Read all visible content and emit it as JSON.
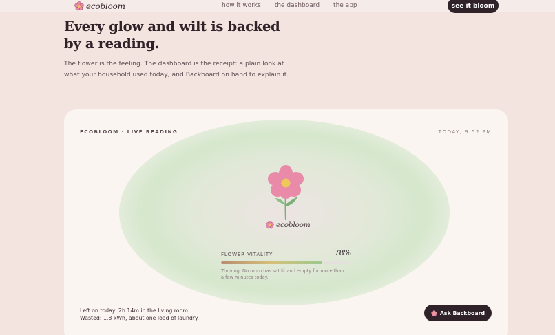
{
  "nav": {
    "logo_text": "ecobloom",
    "links": [
      "how it works",
      "the dashboard",
      "the app"
    ],
    "cta_label": "see it bloom"
  },
  "hero": {
    "headline": "Every glow and wilt is backed by a reading.",
    "subtext": "The flower is the feeling. The dashboard is the receipt: a plain look at what your household used today, and Backboard on hand to explain it."
  },
  "card": {
    "label": "ECOBLOOM · LIVE READING",
    "time": "TODAY, 9:52 PM",
    "logo_text": "ecobloom",
    "vitality": {
      "label": "FLOWER VITALITY",
      "value_text": "78%",
      "fraction": 0.78,
      "status": "Thriving. No room has sat lit and empty for more than a few minutes today."
    },
    "footer": {
      "line1": "Left on today: 2h 14m in the living room.",
      "line2": "Wasted: 1.8 kWh, about one load of laundry."
    },
    "ask_label": "Ask Backboard"
  },
  "colors": {
    "background": "#f3e4df",
    "dark": "#2f2229",
    "petal": "#e88aa8",
    "center": "#f0c85a",
    "stem": "#7cae7a"
  },
  "icons": [
    "flower-logo-icon",
    "flower-illustration",
    "flower-small-icon"
  ]
}
